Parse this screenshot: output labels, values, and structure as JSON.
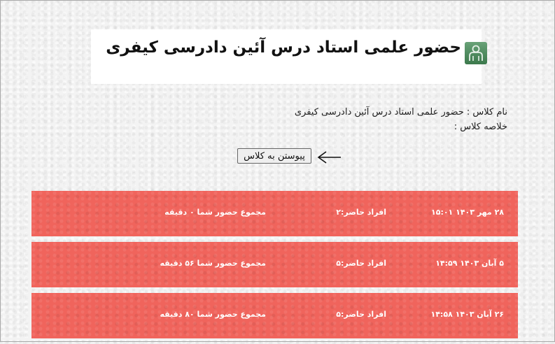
{
  "header": {
    "title": "حضور علمی استاد درس آئین دادرسی کیفری",
    "logo_icon": "people-icon"
  },
  "class_info": {
    "name_line": "نام کلاس : حضور علمی استاد درس آئین دادرسی کیفری",
    "summary_line": "خلاصه کلاس :"
  },
  "join_button": {
    "label": "پیوستن به کلاس"
  },
  "colors": {
    "row_background": "#f0645c",
    "row_text": "#ffffff",
    "logo": "#4a8a5a"
  },
  "sessions": [
    {
      "date": "۲۸ مهر ۱۴۰۳ ۱۵:۰۱",
      "attendees": "افراد حاضر:۲",
      "total": "مجموع حضور شما ۰ دقیقه"
    },
    {
      "date": "۵ آبان ۱۴۰۳ ۱۴:۵۹",
      "attendees": "افراد حاضر:۵",
      "total": "مجموع حضور شما ۵۶ دقیقه"
    },
    {
      "date": "۲۶ آبان ۱۴۰۳ ۱۴:۵۸",
      "attendees": "افراد حاضر:۵",
      "total": "مجموع حضور شما ۸۰ دقیقه"
    }
  ]
}
